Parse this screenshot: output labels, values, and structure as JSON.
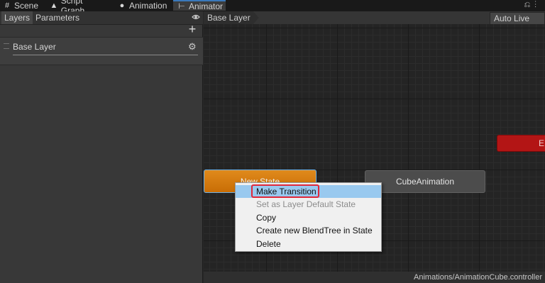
{
  "tabs": [
    {
      "label": "Scene",
      "icon": "grid-icon"
    },
    {
      "label": "Script Graph",
      "icon": "script-graph-icon"
    },
    {
      "label": "Animation",
      "icon": "clock-icon"
    },
    {
      "label": "Animator",
      "icon": "animator-icon",
      "active": true
    }
  ],
  "window_icons": {
    "lock": "lock-icon",
    "menu": "kebab-menu-icon"
  },
  "left_panel": {
    "tabs": [
      "Layers",
      "Parameters"
    ],
    "add_label": "+",
    "layers": [
      {
        "name": "Base Layer"
      }
    ]
  },
  "graph": {
    "breadcrumb": "Base Layer",
    "auto_live_link": "Auto Live Link",
    "nodes": {
      "new_state": "New State",
      "cube": "CubeAnimation",
      "exit_fragment": "E"
    },
    "context_menu": {
      "items": [
        {
          "label": "Make Transition",
          "highlighted": true
        },
        {
          "label": "Set as Layer Default State",
          "disabled": true
        },
        {
          "label": "Copy"
        },
        {
          "label": "Create new BlendTree in State"
        },
        {
          "label": "Delete"
        }
      ]
    },
    "footer_path": "Animations/AnimationCube.controller"
  },
  "colors": {
    "accent": "#3a79bb",
    "default_state": "#d87e10",
    "exit_state": "#b31515",
    "menu_highlight": "#99c9ef",
    "focus_ring": "#e0283a"
  }
}
